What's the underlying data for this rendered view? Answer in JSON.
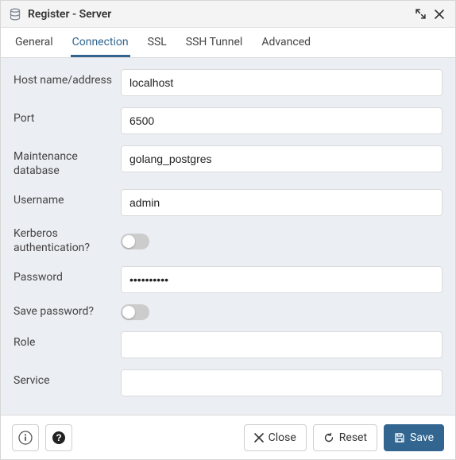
{
  "titlebar": {
    "title": "Register - Server"
  },
  "tabs": [
    {
      "label": "General",
      "active": false
    },
    {
      "label": "Connection",
      "active": true
    },
    {
      "label": "SSL",
      "active": false
    },
    {
      "label": "SSH Tunnel",
      "active": false
    },
    {
      "label": "Advanced",
      "active": false
    }
  ],
  "form": {
    "host_label": "Host name/address",
    "host_value": "localhost",
    "port_label": "Port",
    "port_value": "6500",
    "maintdb_label": "Maintenance database",
    "maintdb_value": "golang_postgres",
    "username_label": "Username",
    "username_value": "admin",
    "kerberos_label": "Kerberos authentication?",
    "kerberos_on": false,
    "password_label": "Password",
    "password_value": "••••••••••",
    "savepw_label": "Save password?",
    "savepw_on": false,
    "role_label": "Role",
    "role_value": "",
    "service_label": "Service",
    "service_value": ""
  },
  "footer": {
    "close_label": "Close",
    "reset_label": "Reset",
    "save_label": "Save"
  }
}
